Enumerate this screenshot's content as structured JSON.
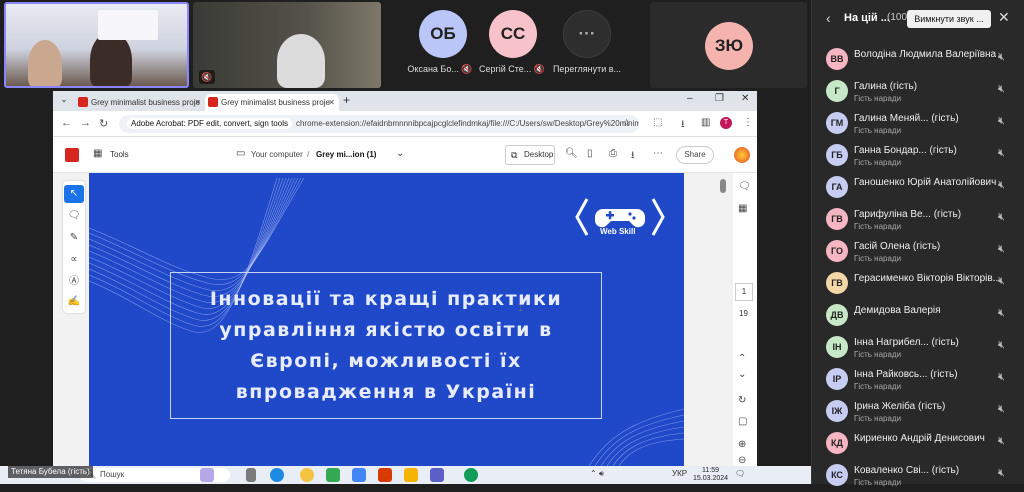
{
  "video_tiles": [
    {
      "caption": ""
    },
    {
      "caption": ""
    }
  ],
  "avatar_tiles": [
    {
      "initials": "ОБ",
      "caption": "Оксана Бо...",
      "color": "#b9c6f7",
      "mic": "mic-off"
    },
    {
      "initials": "СС",
      "caption": "Сергій Сте...",
      "color": "#f7c2c9",
      "mic": "mic-off"
    },
    {
      "initials": "···",
      "caption": "Переглянути в...",
      "color": "#2e2e2e",
      "mic": ""
    },
    {
      "initials": "ЗЮ",
      "caption": "",
      "color": "#f5b3ad",
      "mic": ""
    }
  ],
  "panel": {
    "title": "На цій ...",
    "count": "(100)",
    "mute_all": "Вимкнути звук ...",
    "participants": [
      {
        "initials": "ВВ",
        "name": "Володіна Людмила Валеріївна",
        "role": "",
        "color": "#f5b6c1"
      },
      {
        "initials": "Г",
        "name": "Галина (гість)",
        "role": "Гість наради",
        "color": "#c6e8c6"
      },
      {
        "initials": "ГМ",
        "name": "Галина Меняй... (гість)",
        "role": "Гість наради",
        "color": "#c6ccf2"
      },
      {
        "initials": "ГБ",
        "name": "Ганна Бондар... (гість)",
        "role": "Гість наради",
        "color": "#c6ccf2"
      },
      {
        "initials": "ГА",
        "name": "Ганошенко Юрій Анатолійович",
        "role": "",
        "color": "#c6ccf2"
      },
      {
        "initials": "ГВ",
        "name": "Гарифуліна Ве... (гість)",
        "role": "Гість наради",
        "color": "#f5b6c1"
      },
      {
        "initials": "ГО",
        "name": "Гасій Олена (гість)",
        "role": "Гість наради",
        "color": "#f5b6c1"
      },
      {
        "initials": "ГВ",
        "name": "Герасименко Вікторія Вікторів...",
        "role": "",
        "color": "#f3d7a6"
      },
      {
        "initials": "ДВ",
        "name": "Демидова Валерія",
        "role": "",
        "color": "#c6e8c6"
      },
      {
        "initials": "ІН",
        "name": "Інна Нагрибел... (гість)",
        "role": "Гість наради",
        "color": "#c6e8c6"
      },
      {
        "initials": "ІР",
        "name": "Інна Райковсь... (гість)",
        "role": "Гість наради",
        "color": "#c6ccf2"
      },
      {
        "initials": "ІЖ",
        "name": "Ірина Желіба (гість)",
        "role": "Гість наради",
        "color": "#c6ccf2"
      },
      {
        "initials": "КД",
        "name": "Кириенко Андрій Денисович",
        "role": "",
        "color": "#f5b6c1"
      },
      {
        "initials": "КС",
        "name": "Коваленко Сві... (гість)",
        "role": "Гість наради",
        "color": "#c6ccf2"
      }
    ]
  },
  "browser": {
    "tabs": [
      {
        "label": "Grey minimalist business proje"
      },
      {
        "label": "Grey minimalist business proje"
      }
    ],
    "extension_chip": "Adobe Acrobat: PDF edit, convert, sign tools",
    "url": "chrome-extension://efaidnbmnnnibpcajpcglclefindmkaj/file:///C:/Users/sw/Desktop/Grey%20minim...",
    "profile_initial": "T"
  },
  "acrobat": {
    "tools": "Tools",
    "location": "Your computer",
    "separator": "/",
    "file": "Grey mi...ion (1)",
    "desktop": "Desktop",
    "share": "Share",
    "page_current": "1",
    "page_total": "19"
  },
  "slide": {
    "logo_text": "Web Skill",
    "title_lines": [
      "Інновації та кращі практики",
      "управління якістю освіти в",
      "Європі, можливості їх",
      "впровадження в Україні"
    ],
    "colors": {
      "background": "#1f49c9",
      "text": "#e8ecff"
    }
  },
  "taskbar": {
    "name_caption": "Тетяна Бубела (гість)",
    "search": "Пошук",
    "lang": "УКР",
    "time": "11:59",
    "date": "15.03.2024"
  }
}
